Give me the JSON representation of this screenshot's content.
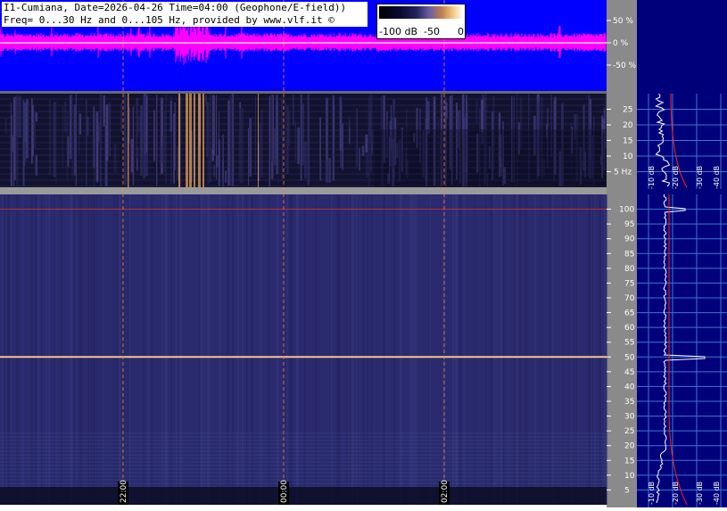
{
  "header": {
    "line1": "I1-Cumiana, Date=2026-04-26 Time=04:00 (Geophone/E-field))",
    "line2": "Freq= 0...30 Hz and 0...105 Hz, provided by www.vlf.it ©"
  },
  "colorbar": {
    "labels": [
      "-100 dB",
      "-50",
      "0"
    ]
  },
  "colors": {
    "waveform_bg": "#0000ff",
    "waveform_trace": "#ff00ff",
    "spectrogram_bg": "#2a2a6e",
    "right_panel_bg": "#00007a",
    "axis_bg": "#8a8a8a",
    "marker_line": "#ff8040",
    "profile_trace": "#ffffff",
    "profile_red": "#ff2020",
    "grid": "#3a78d0"
  },
  "chart_data": [
    {
      "type": "line",
      "title": "",
      "ylabel": "",
      "yticks": [
        "50 %",
        "0 %",
        "-50 %"
      ],
      "ylim": [
        -100,
        100
      ]
    },
    {
      "type": "heatmap",
      "yticks": [
        "25",
        "20",
        "15",
        "10",
        "5 Hz"
      ],
      "ylim": [
        0,
        30
      ]
    },
    {
      "type": "heatmap",
      "yticks": [
        "100",
        "95",
        "90",
        "85",
        "80",
        "75",
        "70",
        "65",
        "60",
        "55",
        "50",
        "45",
        "40",
        "35",
        "30",
        "25",
        "20",
        "15",
        "10",
        "5"
      ],
      "ylim": [
        0,
        105
      ],
      "xticks": [
        "22:00",
        "00:00",
        "02:00"
      ],
      "lines_hz": [
        50,
        100
      ]
    },
    {
      "type": "line",
      "xlabels_top": [
        "-10 dB",
        "-20 dB",
        "-30 dB",
        "-40 dB"
      ],
      "xlabels_bottom": [
        "-10 dB",
        "-20 dB",
        "-30 dB",
        "-40 dB"
      ]
    }
  ]
}
